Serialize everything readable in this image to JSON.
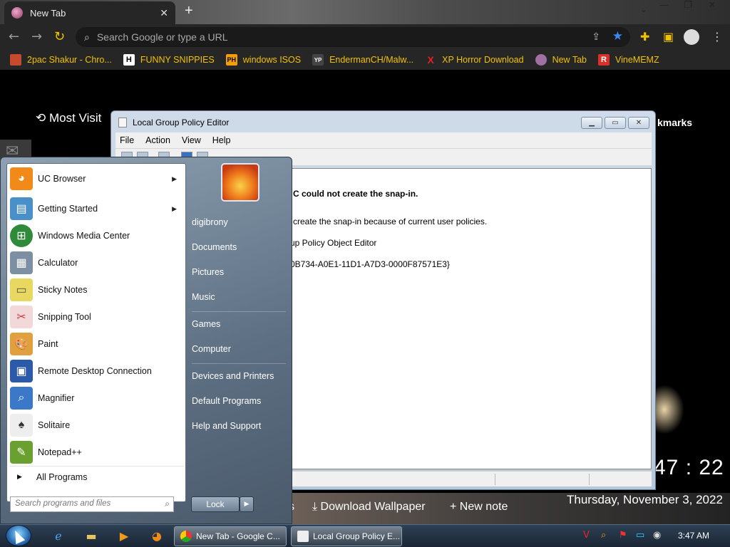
{
  "chrome": {
    "tab_title": "New Tab",
    "tab_close": "✕",
    "new_tab": "+",
    "omnibox_placeholder": "Search Google or type a URL",
    "bookmarks": [
      {
        "label": "2pac Shakur - Chro...",
        "icon_color": "#c64b2e",
        "icon_text": ""
      },
      {
        "label": "FUNNY SNIPPIES",
        "icon_color": "#ffffff",
        "icon_text": "H"
      },
      {
        "label": "windows ISOS",
        "icon_color": "#f29f05",
        "icon_text": "PH"
      },
      {
        "label": "EndermanCH/Malw...",
        "icon_color": "#444444",
        "icon_text": "YP"
      },
      {
        "label": "XP Horror Download",
        "icon_color": "#e52222",
        "icon_text": "X"
      },
      {
        "label": "New Tab",
        "icon_color": "#a070a0",
        "icon_text": ""
      },
      {
        "label": "VineMEMZ",
        "icon_color": "#d6322a",
        "icon_text": "R"
      }
    ]
  },
  "newtab": {
    "most_visited": "Most Visit",
    "bookmarks_label": "kmarks",
    "clock": "47 : 22",
    "date": "Thursday, November 3, 2022",
    "download_wallpaper": "Download Wallpaper",
    "new_note": "+ New note",
    "left_partial": "s"
  },
  "gpedit": {
    "title": "Local Group Policy Editor",
    "menu": [
      "File",
      "Action",
      "View",
      "Help"
    ],
    "error_title": "C could not create the snap-in.",
    "line1": "create the snap-in because of current user policies.",
    "line2": "up Policy Object Editor",
    "line3": "{0B734-A0E1-11D1-A7D3-0000F87571E3}"
  },
  "startmenu": {
    "programs": [
      {
        "label": "UC Browser",
        "icon": "uc-browser-icon",
        "color": "#f28a1a",
        "submenu": true
      },
      {
        "label": "Getting Started",
        "icon": "getting-started-icon",
        "color": "#4a90c8",
        "submenu": true
      },
      {
        "label": "Windows Media Center",
        "icon": "media-center-icon",
        "color": "#2f8a3a",
        "submenu": false
      },
      {
        "label": "Calculator",
        "icon": "calculator-icon",
        "color": "#7d8fa3",
        "submenu": false
      },
      {
        "label": "Sticky Notes",
        "icon": "sticky-notes-icon",
        "color": "#e8d860",
        "submenu": false
      },
      {
        "label": "Snipping Tool",
        "icon": "scissors-icon",
        "color": "#c84040",
        "submenu": false
      },
      {
        "label": "Paint",
        "icon": "paint-icon",
        "color": "#e0a040",
        "submenu": false
      },
      {
        "label": "Remote Desktop Connection",
        "icon": "remote-desktop-icon",
        "color": "#2a5aa8",
        "submenu": false
      },
      {
        "label": "Magnifier",
        "icon": "magnifier-icon",
        "color": "#3c78c8",
        "submenu": false
      },
      {
        "label": "Solitaire",
        "icon": "solitaire-icon",
        "color": "#666666",
        "submenu": false
      },
      {
        "label": "Notepad++",
        "icon": "notepad-plus-icon",
        "color": "#6aa030",
        "submenu": false
      }
    ],
    "all_programs": "All Programs",
    "search_placeholder": "Search programs and files",
    "right_items": [
      "digibrony",
      "Documents",
      "Pictures",
      "Music",
      "Games",
      "Computer",
      "Devices and Printers",
      "Default Programs",
      "Help and Support"
    ],
    "lock": "Lock"
  },
  "taskbar": {
    "chrome_task": "New Tab - Google C...",
    "gpedit_task": "Local Group Policy E...",
    "time": "3:47 AM"
  }
}
